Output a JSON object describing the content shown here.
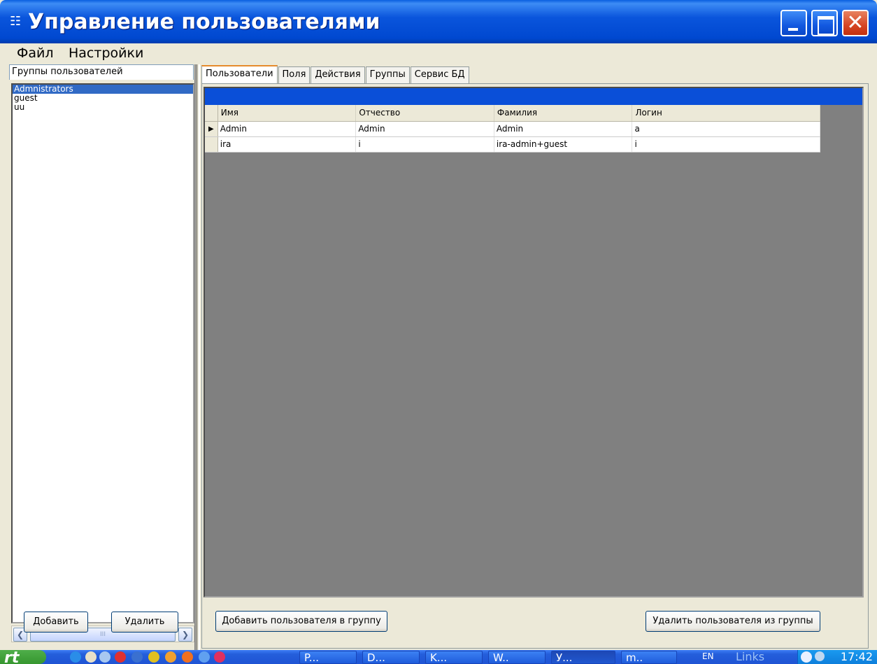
{
  "window": {
    "title": "Управление пользователями",
    "icon": "app-icon"
  },
  "menu": {
    "items": [
      "Файл",
      "Настройки"
    ]
  },
  "groups_panel": {
    "header": "Группы пользователей",
    "items": [
      "Admnistrators",
      "guest",
      "uu"
    ],
    "selected_index": 0,
    "add_label": "Добавить",
    "delete_label": "Удалить",
    "scroll_thumb_label": "III"
  },
  "tabs": [
    "Пользователи",
    "Поля",
    "Действия",
    "Группы",
    "Сервис БД"
  ],
  "active_tab": 0,
  "users_grid": {
    "columns": [
      "Имя",
      "Отчество",
      "Фамилия",
      "Логин"
    ],
    "rows": [
      [
        "Admin",
        "Admin",
        "Admin",
        "a"
      ],
      [
        "ira",
        "i",
        "ira-admin+guest",
        "i"
      ]
    ],
    "current_row": 0
  },
  "actions": {
    "add_to_group_label": "Добавить пользователя в группу",
    "remove_from_group_label": "Удалить пользователя из группы"
  },
  "taskbar": {
    "start_label": "rt",
    "tasks": [
      "P...",
      "D...",
      "K...",
      "W..",
      "У...",
      "m.."
    ],
    "active_task": 4,
    "language": "EN",
    "links_label": "Links",
    "clock": "17:42"
  },
  "colors": {
    "title_bar": "#0a55dc",
    "selection": "#316ac5",
    "grid_background": "#808080",
    "caption_bar": "#0a4fd8"
  }
}
